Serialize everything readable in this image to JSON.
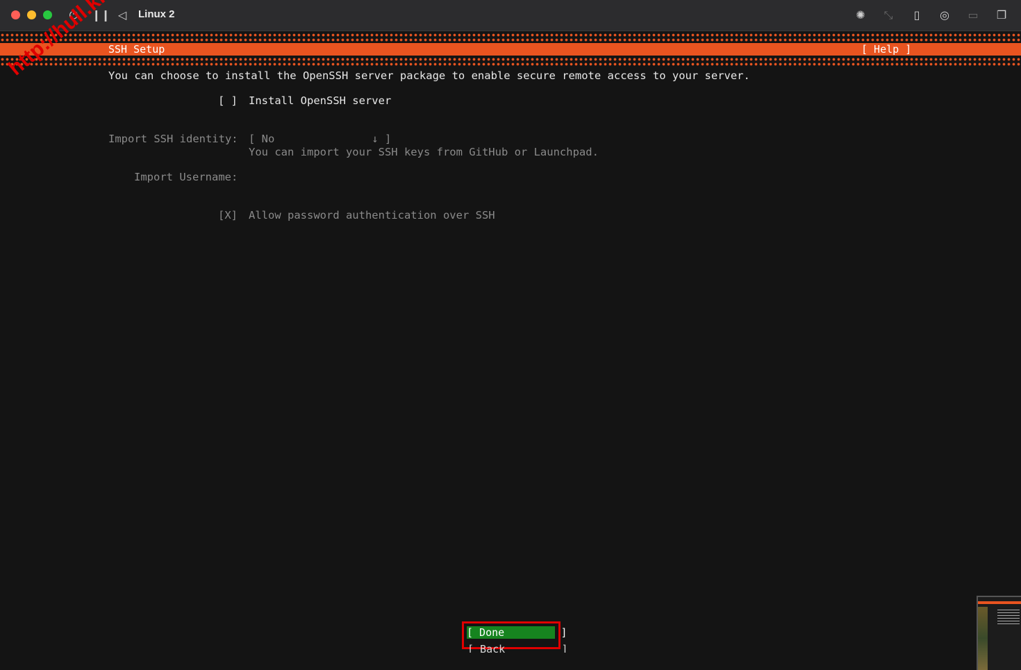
{
  "window": {
    "title": "Linux 2",
    "controls": [
      "power-icon",
      "pause-icon",
      "back-icon"
    ],
    "toolbar_icons": [
      "brightness-icon",
      "resize-icon",
      "usb-icon",
      "network-icon",
      "folder-icon",
      "windows-icon"
    ]
  },
  "installer": {
    "screen_title": "SSH Setup",
    "help": "[ Help ]",
    "intro": "You can choose to install the OpenSSH server package to enable secure remote access to your server.",
    "install_openssh": {
      "checkbox": "[ ]",
      "label": "Install OpenSSH server",
      "checked": false
    },
    "import_identity": {
      "label": "Import SSH identity:",
      "value": "[ No               ↓ ]",
      "hint": "You can import your SSH keys from GitHub or Launchpad."
    },
    "import_username": {
      "label": "Import Username:",
      "value": ""
    },
    "allow_password": {
      "checkbox": "[X]",
      "label": "Allow password authentication over SSH",
      "checked": true
    },
    "buttons": {
      "done": "[ Done         ]",
      "back": "[ Back         ]"
    }
  },
  "watermark": "http://hull.kr",
  "colors": {
    "accent": "#e95420",
    "done_button": "#16841f",
    "highlight_box": "#e00000"
  }
}
